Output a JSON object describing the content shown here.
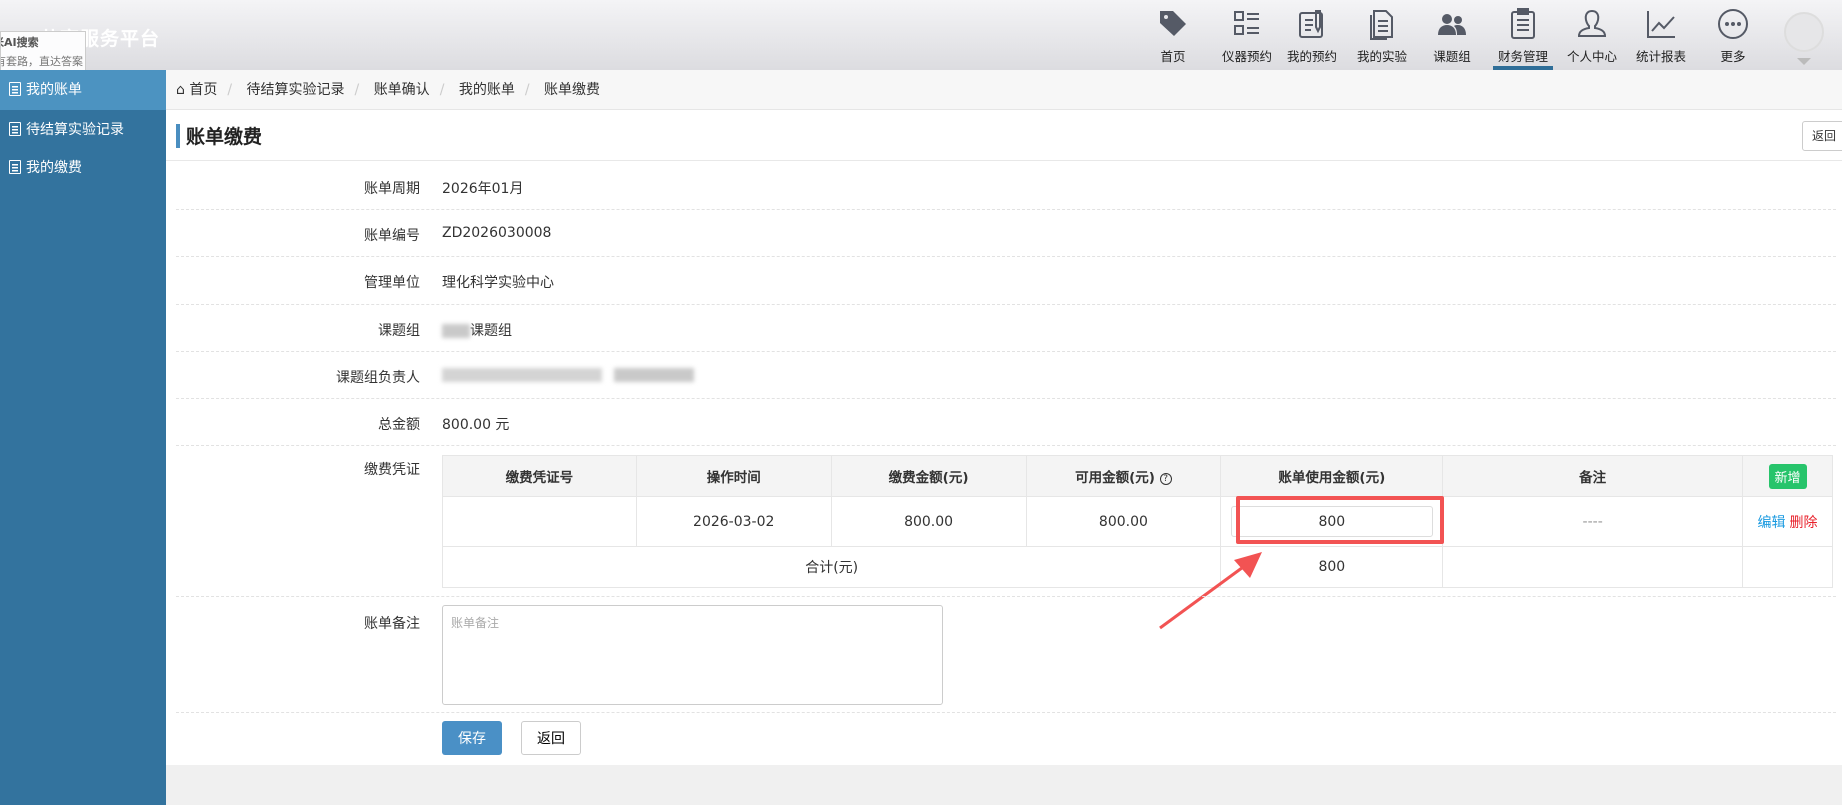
{
  "header": {
    "site_title": "共享服务平台",
    "tooltip": {
      "line1": "米AI搜索",
      "line2": "有套路，直达答案"
    },
    "nav": [
      {
        "label": "首页",
        "icon": "tag-icon"
      },
      {
        "label": "仪器预约",
        "icon": "list-icon"
      },
      {
        "label": "我的预约",
        "icon": "edit-note-icon"
      },
      {
        "label": "我的实验",
        "icon": "documents-icon"
      },
      {
        "label": "课题组",
        "icon": "group-icon"
      },
      {
        "label": "财务管理",
        "icon": "clipboard-icon",
        "active": true
      },
      {
        "label": "个人中心",
        "icon": "user-icon"
      },
      {
        "label": "统计报表",
        "icon": "line-chart-icon"
      },
      {
        "label": "更多",
        "icon": "more-icon"
      }
    ]
  },
  "sidebar": {
    "items": [
      {
        "label": "我的账单",
        "active": true
      },
      {
        "label": "待结算实验记录"
      },
      {
        "label": "我的缴费"
      }
    ]
  },
  "breadcrumb": [
    "首页",
    "待结算实验记录",
    "账单确认",
    "我的账单",
    "账单缴费"
  ],
  "page": {
    "title": "账单缴费",
    "back_top": "返回"
  },
  "form": {
    "period": {
      "label": "账单周期",
      "value": "2026年01月"
    },
    "number": {
      "label": "账单编号",
      "value": "ZD2026030008"
    },
    "unit": {
      "label": "管理单位",
      "value": "理化科学实验中心"
    },
    "group": {
      "label": "课题组",
      "value": "课题组"
    },
    "leader": {
      "label": "课题组负责人"
    },
    "total": {
      "label": "总金额",
      "value": "800.00 元"
    },
    "voucher_label": "缴费凭证",
    "remark": {
      "label": "账单备注",
      "placeholder": "账单备注"
    }
  },
  "table": {
    "headers": [
      "缴费凭证号",
      "操作时间",
      "缴费金额(元)",
      "可用金额(元)",
      "账单使用金额(元)",
      "备注"
    ],
    "add_label": "新增",
    "rows": [
      {
        "voucher": "",
        "time": "2026-03-02",
        "paid": "800.00",
        "available": "800.00",
        "used": "800",
        "note": "----",
        "edit": "编辑",
        "delete": "删除"
      }
    ],
    "total_label": "合计(元)",
    "total_value": "800"
  },
  "buttons": {
    "save": "保存",
    "back": "返回"
  },
  "colors": {
    "sidebar": "#33739e",
    "sidebar_active": "#4c93c1",
    "highlight": "#f25353",
    "add": "#27c46b"
  }
}
